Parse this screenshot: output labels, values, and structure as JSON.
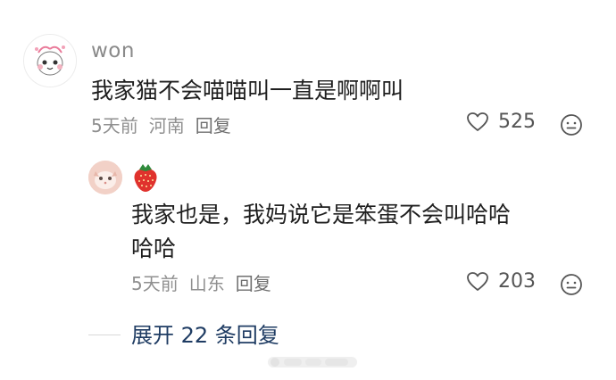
{
  "comment": {
    "username": "won",
    "text": "我家猫不会喵喵叫一直是啊啊叫",
    "time": "5天前",
    "location": "河南",
    "reply_label": "回复",
    "likes": "525"
  },
  "reply": {
    "name_icon": "strawberry-icon",
    "text_line1": "我家也是，我妈说它是笨蛋不会叫哈哈",
    "text_line2": "哈哈",
    "time": "5天前",
    "location": "山东",
    "reply_label": "回复",
    "likes": "203"
  },
  "expand": {
    "label": "展开 22 条回复"
  },
  "colors": {
    "text": "#1f1f1f",
    "meta": "#8f8f8f",
    "link": "#1f3c63"
  }
}
